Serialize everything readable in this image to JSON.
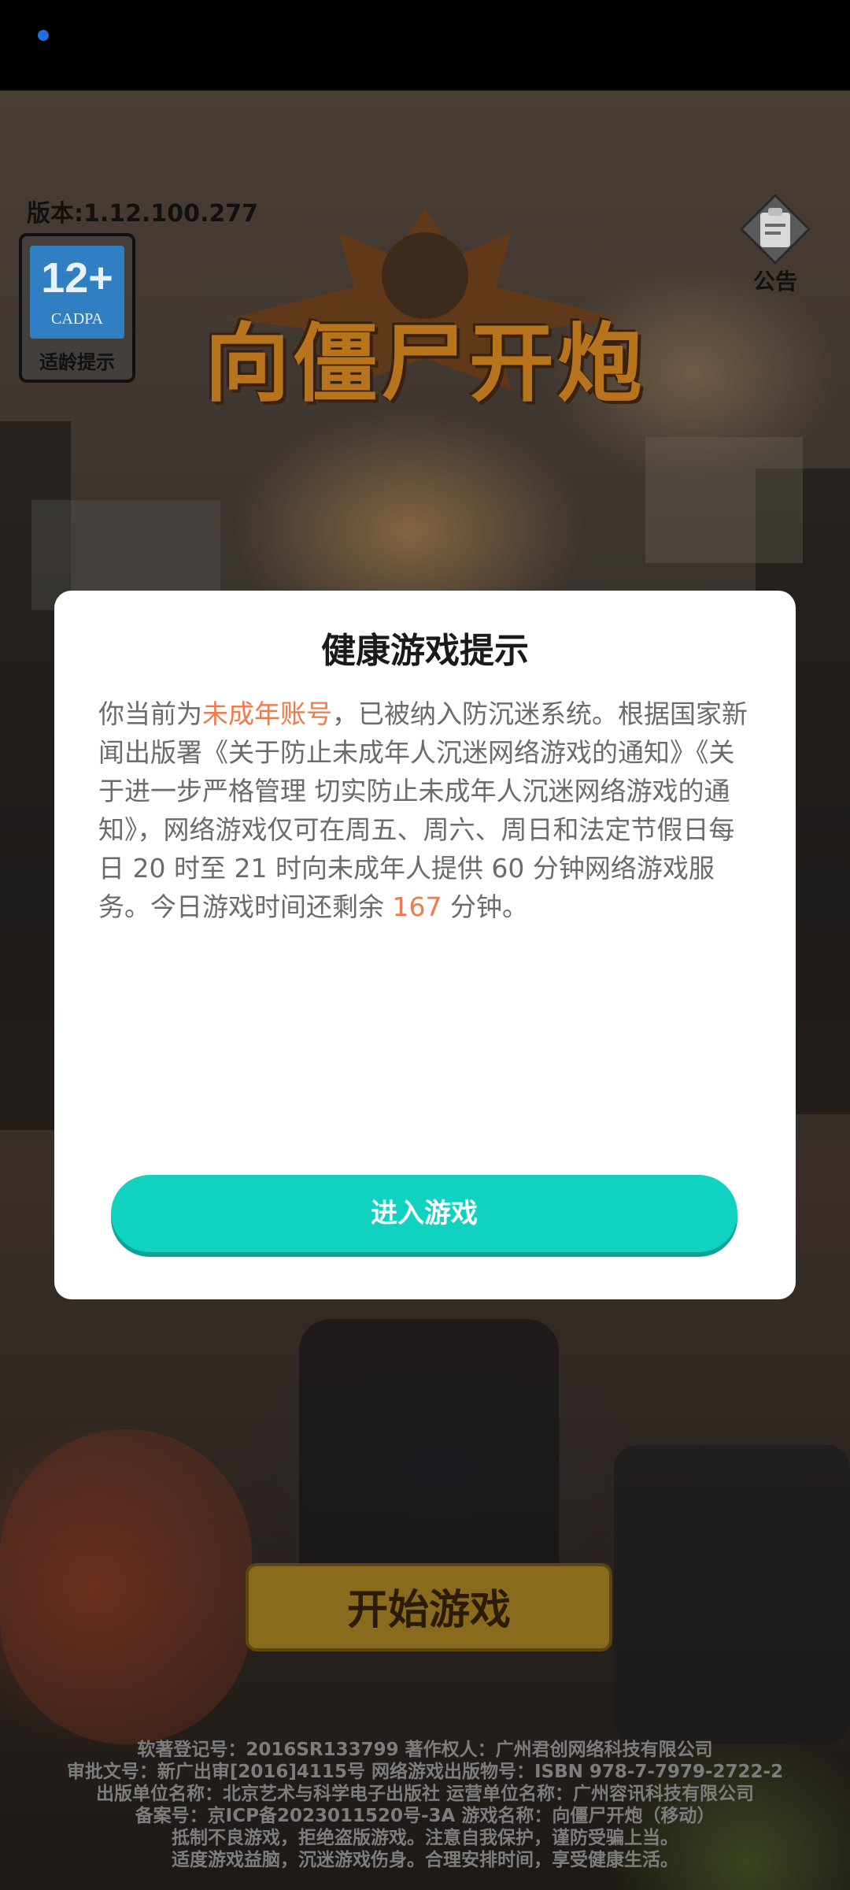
{
  "game": {
    "version": "版本:1.12.100.277",
    "age_rating": {
      "number": "12+",
      "org": "CADPA",
      "label": "适龄提示"
    },
    "notice": {
      "label": "公告",
      "icon": "clipboard-icon"
    },
    "logo_text": "向僵尸开炮",
    "start_button": "开始游戏"
  },
  "modal": {
    "title": "健康游戏提示",
    "body": {
      "part1": "你当前为",
      "highlight1": "未成年账号",
      "part2": "，已被纳入防沉迷系统。根据国家新闻出版署《关于防止未成年人沉迷网络游戏的通知》《关于进一步严格管理 切实防止未成年人沉迷网络游戏的通知》，网络游戏仅可在周五、周六、周日和法定节假日每日 20 时至 21 时向未成年人提供 60 分钟网络游戏服务。今日游戏时间还剩余 ",
      "highlight2": "167",
      "part3": " 分钟。"
    },
    "enter_button": "进入游戏"
  },
  "footer": {
    "lines": [
      "软著登记号：2016SR133799  著作权人：广州君创网络科技有限公司",
      "审批文号：新广出审[2016]4115号  网络游戏出版物号：ISBN 978-7-7979-2722-2",
      "出版单位名称：北京艺术与科学电子出版社  运营单位名称：广州容讯科技有限公司",
      "备案号：京ICP备2023011520号-3A  游戏名称：向僵尸开炮（移动）",
      "抵制不良游戏，拒绝盗版游戏。注意自我保护，谨防受骗上当。",
      "适度游戏益脑，沉迷游戏伤身。合理安排时间，享受健康生活。"
    ]
  },
  "colors": {
    "accent": "#10d2c0",
    "highlight": "#f07a4a",
    "status_dot": "#1e6fe0"
  }
}
